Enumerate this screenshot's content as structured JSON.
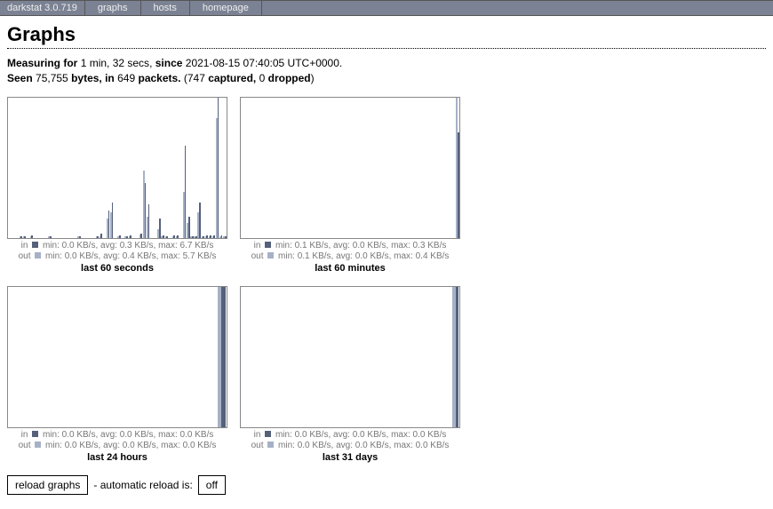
{
  "nav": {
    "app_name": "darkstat 3.0.719",
    "items": [
      "graphs",
      "hosts",
      "homepage"
    ]
  },
  "title": "Graphs",
  "status": {
    "measuring_label": "Measuring for",
    "duration": "1 min, 32 secs",
    "since_label": "since",
    "since_time": "2021-08-15 07:40:05 UTC+0000",
    "seen_label": "Seen",
    "bytes": "75,755",
    "bytes_label": "bytes, in",
    "packets": "649",
    "packets_label": "packets.",
    "captured": "747",
    "captured_label": "captured,",
    "dropped": "0",
    "dropped_label": "dropped"
  },
  "legend_labels": {
    "in": "in",
    "out": "out"
  },
  "controls": {
    "reload_label": "reload graphs",
    "auto_text": "- automatic reload is:",
    "auto_state": "off"
  },
  "colors": {
    "in": "#55607a",
    "out": "#a6b1c7"
  },
  "chart_data": [
    {
      "id": "seconds",
      "title": "last 60 seconds",
      "type": "bar",
      "xlabel": "",
      "ylabel": "KB/s",
      "ylim_in": [
        0,
        6.7
      ],
      "ylim_out": [
        0,
        5.7
      ],
      "n_slots": 60,
      "series": [
        {
          "name": "in",
          "min": "0.0 KB/s",
          "avg": "0.3 KB/s",
          "max": "6.7 KB/s",
          "values_nonzero": {
            "3": 0.05,
            "4": 0.05,
            "6": 0.1,
            "11": 0.05,
            "19": 0.05,
            "24": 0.05,
            "25": 0.2,
            "27": 1.3,
            "28": 1.7,
            "30": 0.1,
            "32": 0.05,
            "33": 0.1,
            "36": 0.2,
            "37": 2.6,
            "38": 1.6,
            "41": 0.9,
            "42": 0.1,
            "43": 0.05,
            "45": 0.1,
            "46": 0.1,
            "48": 4.4,
            "49": 1.0,
            "50": 0.05,
            "51": 0.05,
            "52": 1.7,
            "53": 0.05,
            "54": 0.1,
            "55": 0.1,
            "56": 0.1,
            "57": 6.7,
            "58": 0.1,
            "59": 0.05
          }
        },
        {
          "name": "out",
          "min": "0.0 KB/s",
          "avg": "0.4 KB/s",
          "max": "5.7 KB/s",
          "values_nonzero": {
            "3": 0.05,
            "4": 0.05,
            "6": 0.05,
            "11": 0.05,
            "19": 0.05,
            "24": 0.05,
            "25": 0.05,
            "27": 0.9,
            "28": 1.2,
            "30": 0.05,
            "32": 0.05,
            "33": 0.05,
            "36": 0.15,
            "37": 3.2,
            "38": 1.0,
            "41": 0.4,
            "42": 0.05,
            "43": 0.05,
            "45": 0.05,
            "46": 0.05,
            "48": 2.2,
            "49": 0.7,
            "50": 0.05,
            "51": 0.05,
            "52": 1.2,
            "53": 0.05,
            "54": 0.05,
            "55": 0.05,
            "56": 0.05,
            "57": 5.7,
            "58": 0.05,
            "59": 0.05
          }
        }
      ]
    },
    {
      "id": "minutes",
      "title": "last 60 minutes",
      "type": "bar",
      "xlabel": "",
      "ylabel": "KB/s",
      "ylim_in": [
        0,
        0.3
      ],
      "ylim_out": [
        0,
        0.4
      ],
      "n_slots": 60,
      "series": [
        {
          "name": "in",
          "min": "0.1 KB/s",
          "avg": "0.0 KB/s",
          "max": "0.3 KB/s",
          "values_nonzero": {
            "59": 0.3
          }
        },
        {
          "name": "out",
          "min": "0.1 KB/s",
          "avg": "0.0 KB/s",
          "max": "0.4 KB/s",
          "values_nonzero": {
            "59": 0.4
          }
        }
      ]
    },
    {
      "id": "hours",
      "title": "last 24 hours",
      "type": "bar",
      "xlabel": "",
      "ylabel": "KB/s",
      "ylim_in": [
        0,
        0.0
      ],
      "ylim_out": [
        0,
        0.0
      ],
      "n_slots": 24,
      "series": [
        {
          "name": "in",
          "min": "0.0 KB/s",
          "avg": "0.0 KB/s",
          "max": "0.0 KB/s",
          "values_nonzero": {
            "23": 0.0001
          }
        },
        {
          "name": "out",
          "min": "0.0 KB/s",
          "avg": "0.0 KB/s",
          "max": "0.0 KB/s",
          "values_nonzero": {
            "23": 0.0001
          }
        }
      ]
    },
    {
      "id": "days",
      "title": "last 31 days",
      "type": "bar",
      "xlabel": "",
      "ylabel": "KB/s",
      "ylim_in": [
        0,
        0.0
      ],
      "ylim_out": [
        0,
        0.0
      ],
      "n_slots": 31,
      "series": [
        {
          "name": "in",
          "min": "0.0 KB/s",
          "avg": "0.0 KB/s",
          "max": "0.0 KB/s",
          "values_nonzero": {
            "30": 0.0001
          }
        },
        {
          "name": "out",
          "min": "0.0 KB/s",
          "avg": "0.0 KB/s",
          "max": "0.0 KB/s",
          "values_nonzero": {
            "30": 0.0001
          }
        }
      ]
    }
  ]
}
